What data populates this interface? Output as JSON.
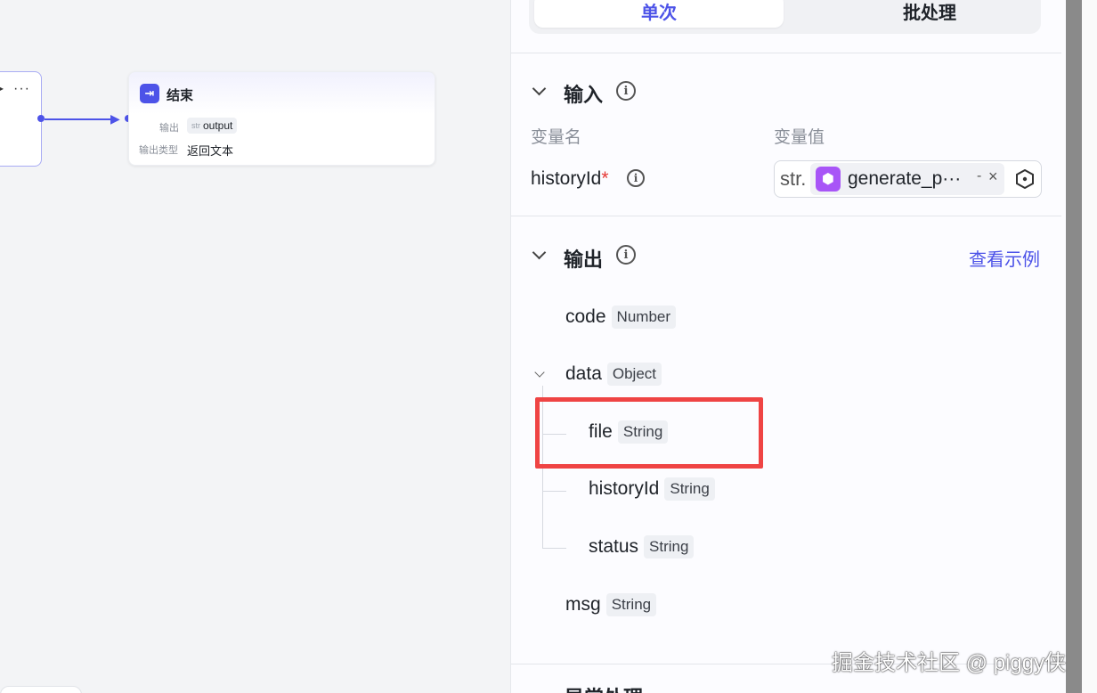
{
  "canvas": {
    "end_node": {
      "title": "结束",
      "output_label": "输出",
      "output_type_short": "str",
      "output_var": "output",
      "output_kind_label": "输出类型",
      "output_kind_value": "返回文本"
    },
    "left_node": {
      "more": "···"
    }
  },
  "panel": {
    "tabs": [
      {
        "label": "单次",
        "active": true
      },
      {
        "label": "批处理",
        "active": false
      }
    ],
    "input_section": {
      "title": "输入",
      "col_name": "变量名",
      "col_value": "变量值",
      "params": [
        {
          "name": "historyId",
          "required_mark": "*",
          "type_short": "str.",
          "ref_name": "generate_p···",
          "ref_suffix": "-"
        }
      ]
    },
    "output_section": {
      "title": "输出",
      "view_example": "查看示例",
      "fields": [
        {
          "name": "code",
          "type": "Number"
        },
        {
          "name": "data",
          "type": "Object",
          "children": [
            {
              "name": "file",
              "type": "String"
            },
            {
              "name": "historyId",
              "type": "String"
            },
            {
              "name": "status",
              "type": "String"
            }
          ]
        },
        {
          "name": "msg",
          "type": "String"
        }
      ]
    },
    "next_section_title": "异常处理"
  },
  "colors": {
    "accent": "#4d53e8",
    "highlight": "#ef4444",
    "plugin": "#a855f7"
  },
  "watermark": "掘金技术社区 @ piggy侠"
}
